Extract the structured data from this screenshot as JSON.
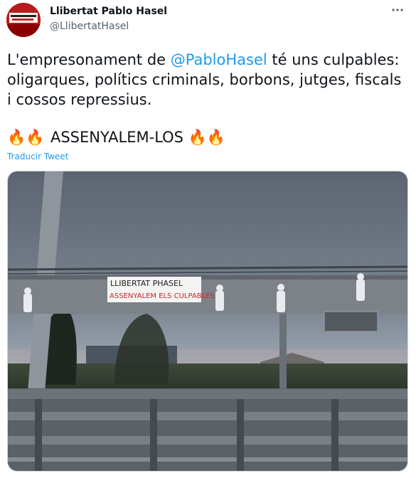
{
  "author": {
    "display_name": "Llibertat Pablo Hasel",
    "handle": "@LlibertatHasel",
    "avatar_icon": "avatar-image"
  },
  "tweet": {
    "text_prefix": "L'empresonament de ",
    "mention": "@PabloHasel",
    "text_suffix": " té uns culpables: oligarques, polítics criminals, borbons, jutges, fiscals i cossos repressius.",
    "line2_emoji_left": "🔥🔥",
    "line2_text": " ASSENYALEM-LOS ",
    "line2_emoji_right": "🔥🔥",
    "translate_label": "Traducir Tweet"
  },
  "photo": {
    "banner_line1": "LLIBERTAT PHASEL",
    "banner_line2": "ASSENYALEM ELS CULPABLES"
  },
  "icons": {
    "more": "more-icon"
  },
  "colors": {
    "accent": "#1d9bf0",
    "text": "#0f1419",
    "secondary": "#536471"
  }
}
